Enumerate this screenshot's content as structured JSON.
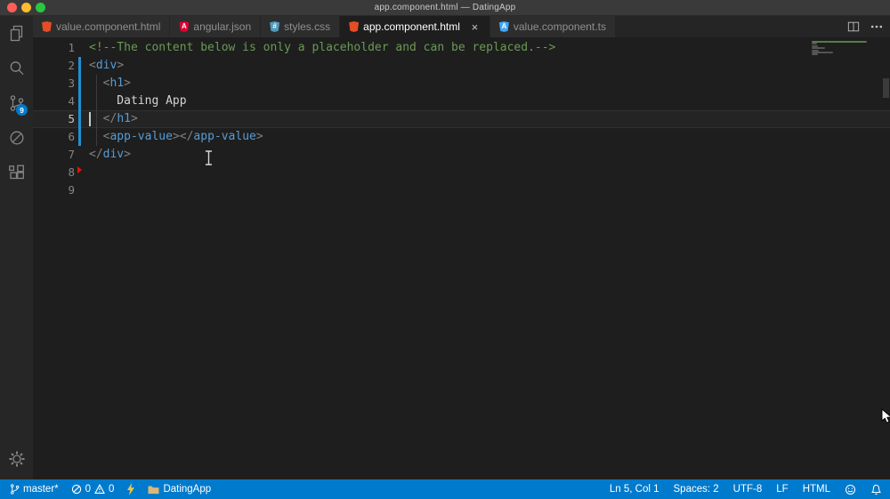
{
  "window": {
    "title": "app.component.html — DatingApp"
  },
  "theme": {
    "titlebar_bg": "#3a3a3a",
    "activitybar_bg": "#262626",
    "tabbar_bg": "#252526",
    "tab_inactive_bg": "#2d2d2d",
    "editor_bg": "#1e1e1e",
    "statusbar_bg": "#007acc",
    "badge_bg": "#007acc",
    "gutter_modified": "#2090d3",
    "gutter_removed": "#e51400"
  },
  "activity_bar": {
    "source_control_badge": "9"
  },
  "tab_bar": {
    "tabs": [
      {
        "label": "value.component.html",
        "icon": "html",
        "icon_color": "#e44d26",
        "icon_letter": "",
        "active": false
      },
      {
        "label": "angular.json",
        "icon": "angular",
        "icon_color": "#dd0031",
        "icon_letter": "A",
        "active": false
      },
      {
        "label": "styles.css",
        "icon": "css",
        "icon_color": "#519aba",
        "icon_letter": "#",
        "active": false
      },
      {
        "label": "app.component.html",
        "icon": "html",
        "icon_color": "#e44d26",
        "icon_letter": "",
        "active": true,
        "close": "×"
      },
      {
        "label": "value.component.ts",
        "icon": "angular-ts",
        "icon_color": "#42a5f5",
        "icon_letter": "A",
        "active": false
      }
    ]
  },
  "editor": {
    "active_line": 5,
    "colors": {
      "comment": "#6a9955",
      "punct": "#808080",
      "tag": "#569cd6",
      "text": "#d4d4d4"
    },
    "lines": [
      {
        "num": "1",
        "gutter": null,
        "segments": [
          {
            "t": "<!--The content below is only a placeholder and can be replaced.-->",
            "c": "comment"
          }
        ]
      },
      {
        "num": "2",
        "gutter": "modified",
        "segments": [
          {
            "t": "<",
            "c": "punct"
          },
          {
            "t": "div",
            "c": "tag"
          },
          {
            "t": ">",
            "c": "punct"
          }
        ]
      },
      {
        "num": "3",
        "gutter": "modified",
        "segments": [
          {
            "t": "  ",
            "c": "text"
          },
          {
            "t": "<",
            "c": "punct"
          },
          {
            "t": "h1",
            "c": "tag"
          },
          {
            "t": ">",
            "c": "punct"
          }
        ]
      },
      {
        "num": "4",
        "gutter": "modified",
        "segments": [
          {
            "t": "    Dating App",
            "c": "text"
          }
        ]
      },
      {
        "num": "5",
        "gutter": "modified",
        "segments": [
          {
            "t": "  ",
            "c": "text"
          },
          {
            "t": "</",
            "c": "punct"
          },
          {
            "t": "h1",
            "c": "tag"
          },
          {
            "t": ">",
            "c": "punct"
          }
        ]
      },
      {
        "num": "6",
        "gutter": "modified",
        "segments": [
          {
            "t": "  ",
            "c": "text"
          },
          {
            "t": "<",
            "c": "punct"
          },
          {
            "t": "app-value",
            "c": "tag"
          },
          {
            "t": ">",
            "c": "punct"
          },
          {
            "t": "</",
            "c": "punct"
          },
          {
            "t": "app-value",
            "c": "tag"
          },
          {
            "t": ">",
            "c": "punct"
          }
        ]
      },
      {
        "num": "7",
        "gutter": null,
        "segments": [
          {
            "t": "</",
            "c": "punct"
          },
          {
            "t": "div",
            "c": "tag"
          },
          {
            "t": ">",
            "c": "punct"
          }
        ]
      },
      {
        "num": "8",
        "gutter": "removed",
        "segments": []
      },
      {
        "num": "9",
        "gutter": null,
        "segments": []
      }
    ]
  },
  "status_bar": {
    "branch": "master*",
    "errors": "0",
    "warnings": "0",
    "folder": "DatingApp",
    "cursor_position": "Ln 5, Col 1",
    "indentation": "Spaces: 2",
    "encoding": "UTF-8",
    "eol": "LF",
    "language": "HTML"
  }
}
